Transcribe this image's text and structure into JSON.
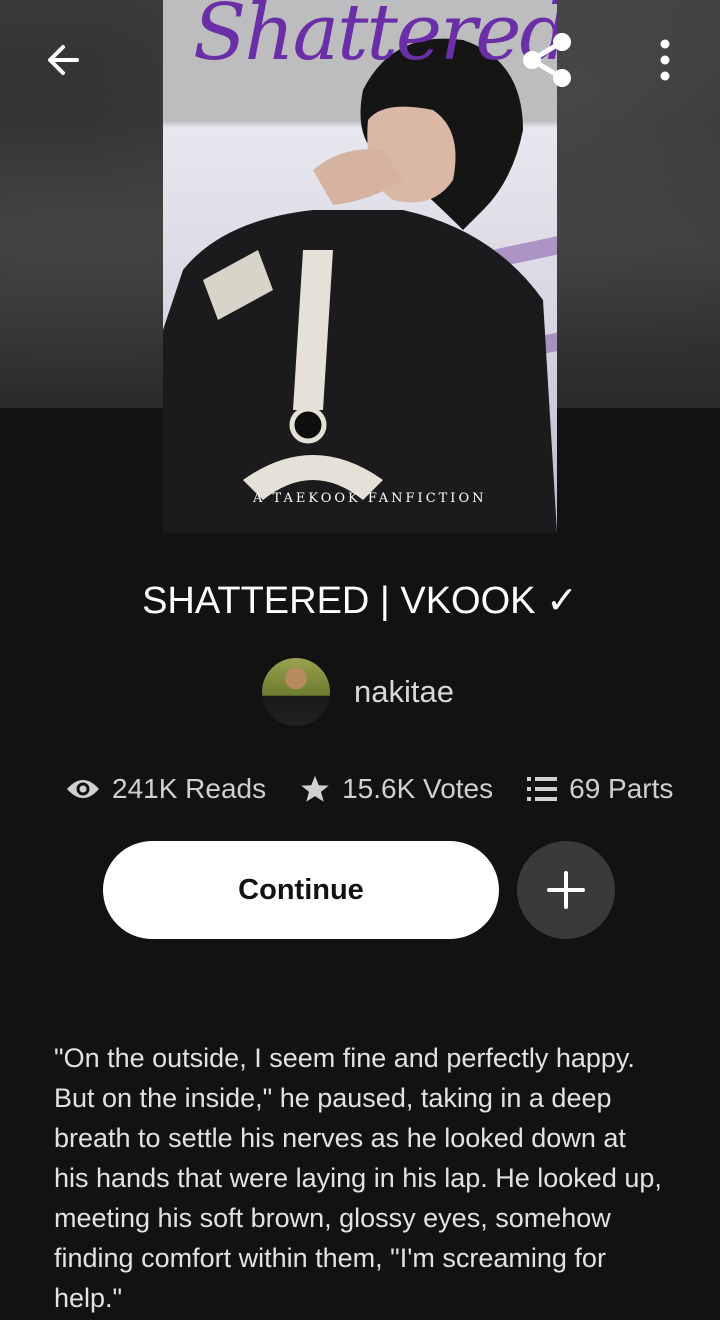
{
  "cover": {
    "title_script": "Shattered",
    "subtitle": "A TAEKOOK FANFICTION"
  },
  "story": {
    "title": "SHATTERED | VKOOK ✓",
    "author": "nakitae",
    "reads": "241K Reads",
    "votes": "15.6K Votes",
    "parts": "69 Parts",
    "description": "\"On the outside, I seem fine and perfectly happy. But on the inside,\" he paused, taking in a deep breath to settle his nerves as he looked down at his hands that were laying in his lap. He looked up, meeting his soft brown, glossy eyes, somehow finding comfort within them, \"I'm screaming for help.\""
  },
  "actions": {
    "continue_label": "Continue"
  },
  "icons": {
    "back": "arrow-left-icon",
    "share": "share-icon",
    "more": "more-vertical-icon",
    "reads": "eye-icon",
    "votes": "star-icon",
    "parts": "list-icon",
    "add": "plus-icon"
  },
  "colors": {
    "background": "#121212",
    "cover_title": "#6a2fa6",
    "button_bg": "#ffffff",
    "add_button_bg": "#3a3a3a"
  }
}
